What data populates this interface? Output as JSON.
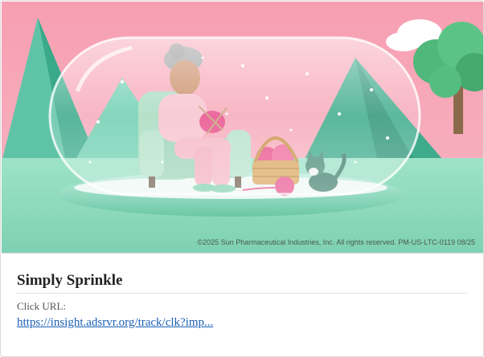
{
  "ad": {
    "copyright": "©2025 Sun Pharmaceutical Industries, Inc. All rights reserved. PM-US-LTC-0119 08/25",
    "scene": {
      "sky_color": "#f4a9b8",
      "ground_color": "#8fdcc0",
      "capsule_color": "#e8f6f2",
      "yarn_color": "#e8508c",
      "chair_color": "#a9dcc0"
    }
  },
  "card": {
    "title": "Simply Sprinkle",
    "click_url_label": "Click URL:",
    "click_url": "https://insight.adsrvr.org/track/clk?imp..."
  }
}
